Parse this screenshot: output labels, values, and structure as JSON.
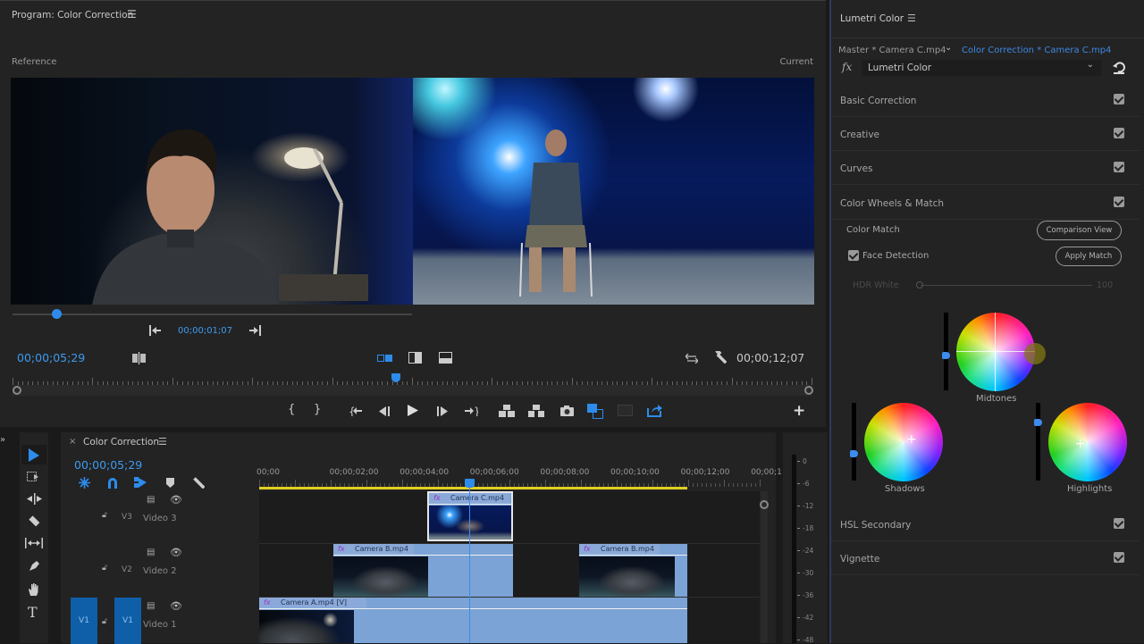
{
  "program": {
    "title": "Program: Color Correction",
    "menu_icon": "hamburger-menu-icon",
    "reference_label": "Reference",
    "current_label": "Current",
    "reference_timecode": "00;00;01;07",
    "reference_position": 0.11,
    "playhead_timecode": "00;00;05;29",
    "duration_timecode": "00;00;12;07",
    "playhead_position": 0.48,
    "buttons": {
      "mark_in": "mark-in-icon",
      "mark_out": "mark-out-icon",
      "go_to_in": "go-to-in-icon",
      "step_back": "step-back-icon",
      "play": "play-icon",
      "step_forward": "step-forward-icon",
      "go_to_out": "go-to-out-icon",
      "lift": "lift-icon",
      "extract": "extract-icon",
      "export_frame": "camera-icon",
      "comparison_view": "comparison-view-icon",
      "safe_margins": "safe-margins-icon",
      "export": "export-icon",
      "add": "plus-icon"
    }
  },
  "lumetri": {
    "title": "Lumetri Color",
    "master_clip": "Master * Camera C.mp4",
    "sequence_clip": "Color Correction * Camera C.mp4",
    "effect_select": "Lumetri Color",
    "sections": [
      {
        "label": "Basic Correction",
        "enabled": true
      },
      {
        "label": "Creative",
        "enabled": true
      },
      {
        "label": "Curves",
        "enabled": true
      },
      {
        "label": "Color Wheels & Match",
        "enabled": true
      },
      {
        "label": "HSL Secondary",
        "enabled": true
      },
      {
        "label": "Vignette",
        "enabled": true
      }
    ],
    "color_match_label": "Color Match",
    "comparison_view_btn": "Comparison View",
    "face_detection_label": "Face Detection",
    "face_detection_checked": true,
    "apply_match_btn": "Apply Match",
    "hdr_white_label": "HDR White",
    "hdr_white_value": "100",
    "wheels": [
      {
        "label": "Midtones",
        "slider_level": 0.45
      },
      {
        "label": "Shadows",
        "slider_level": 0.35
      },
      {
        "label": "Highlights",
        "slider_level": 0.75
      }
    ]
  },
  "timeline": {
    "tab_title": "Color Correction",
    "timecode": "00;00;05;29",
    "ruler": [
      "00;00",
      "00;00;02;00",
      "00;00;04;00",
      "00;00;06;00",
      "00;00;08;00",
      "00;00;10;00",
      "00;00;12;00",
      "00;00;1"
    ],
    "tracks": [
      {
        "id": "V3",
        "name": "Video 3",
        "source": ""
      },
      {
        "id": "V2",
        "name": "Video 2",
        "source": ""
      },
      {
        "id": "V1",
        "name": "Video 1",
        "source": "V1"
      }
    ],
    "clips": [
      {
        "name": "Camera C.mp4",
        "track": "V3"
      },
      {
        "name": "Camera B.mp4",
        "track": "V2"
      },
      {
        "name": "Camera B.mp4",
        "track": "V2"
      },
      {
        "name": "Camera A.mp4 [V]",
        "track": "V1"
      }
    ]
  },
  "audio_meter": {
    "ticks": [
      "0",
      "-6",
      "-12",
      "-18",
      "-24",
      "-30",
      "-36",
      "-42",
      "-48"
    ]
  }
}
